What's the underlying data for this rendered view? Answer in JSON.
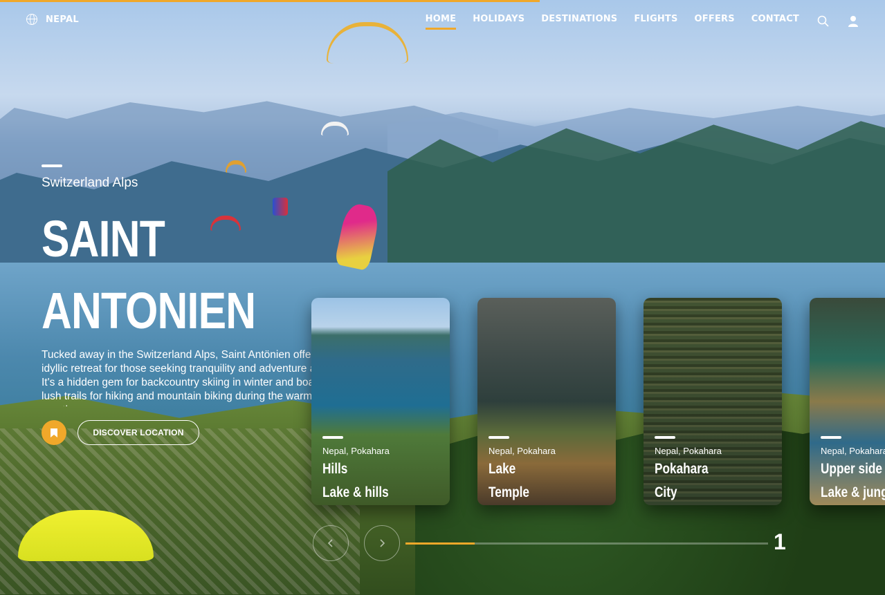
{
  "top_progress": 0.61,
  "brand": {
    "label": "NEPAL",
    "icon": "globe-icon"
  },
  "nav": {
    "items": [
      {
        "label": "HOME",
        "active": true
      },
      {
        "label": "HOLIDAYS",
        "active": false
      },
      {
        "label": "DESTINATIONS",
        "active": false
      },
      {
        "label": "FLIGHTS",
        "active": false
      },
      {
        "label": "OFFERS",
        "active": false
      },
      {
        "label": "CONTACT",
        "active": false
      }
    ],
    "search_icon": "search-icon",
    "user_icon": "user-icon"
  },
  "hero": {
    "subtitle": "Switzerland Alps",
    "title_line1": "SAINT",
    "title_line2": "ANTONIEN",
    "description": "Tucked away in the Switzerland Alps, Saint Antönien offers an idyllic retreat for those seeking tranquility and adventure alike. It's a hidden gem for backcountry skiing in winter and boasts lush trails for hiking and mountain biking during the warmer months.",
    "bookmark_icon": "bookmark-icon",
    "discover_label": "DISCOVER LOCATION"
  },
  "cards": [
    {
      "place": "Nepal, Pokahara",
      "title1": "Hills",
      "title2": "Lake & hills"
    },
    {
      "place": "Nepal, Pokahara",
      "title1": "Lake",
      "title2": "Temple"
    },
    {
      "place": "Nepal, Pokahara",
      "title1": "Pokahara",
      "title2": "City"
    },
    {
      "place": "Nepal, Pokahara",
      "title1": "Upper side",
      "title2": "Lake & jungle"
    }
  ],
  "slider": {
    "prev_icon": "chevron-left-icon",
    "next_icon": "chevron-right-icon",
    "progress": 0.19,
    "current": "1"
  },
  "colors": {
    "accent": "#f0a82a",
    "text": "#ffffff"
  }
}
